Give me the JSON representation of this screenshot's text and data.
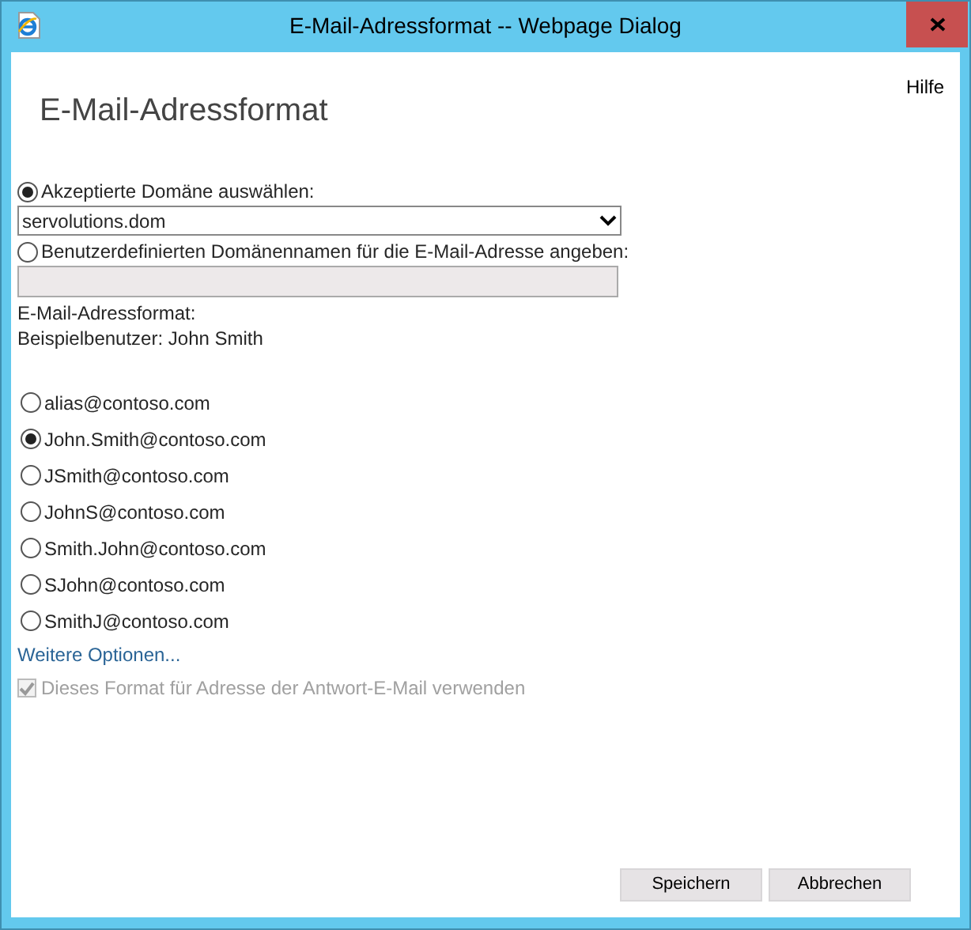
{
  "window": {
    "title": "E-Mail-Adressformat -- Webpage Dialog"
  },
  "help_link": "Hilfe",
  "heading": "E-Mail-Adressformat",
  "domain_options": [
    {
      "label": "Akzeptierte Domäne auswählen:",
      "selected": true,
      "kind": "dropdown",
      "value": "servolutions.dom"
    },
    {
      "label": "Benutzerdefinierten Domänennamen für die E-Mail-Adresse angeben:",
      "selected": false,
      "kind": "text",
      "disabled": true
    }
  ],
  "format_label": "E-Mail-Adressformat:",
  "example_user": "Beispielbenutzer: John Smith",
  "formats": [
    {
      "label": "alias@contoso.com",
      "selected": false
    },
    {
      "label": "John.Smith@contoso.com",
      "selected": true
    },
    {
      "label": "JSmith@contoso.com",
      "selected": false
    },
    {
      "label": "JohnS@contoso.com",
      "selected": false
    },
    {
      "label": "Smith.John@contoso.com",
      "selected": false
    },
    {
      "label": "SJohn@contoso.com",
      "selected": false
    },
    {
      "label": "SmithJ@contoso.com",
      "selected": false
    }
  ],
  "more_options": "Weitere Optionen...",
  "reply_format": {
    "label": "Dieses Format für Adresse der Antwort-E-Mail verwenden",
    "checked": true,
    "disabled": true
  },
  "buttons": [
    "Speichern",
    "Abbrechen"
  ]
}
